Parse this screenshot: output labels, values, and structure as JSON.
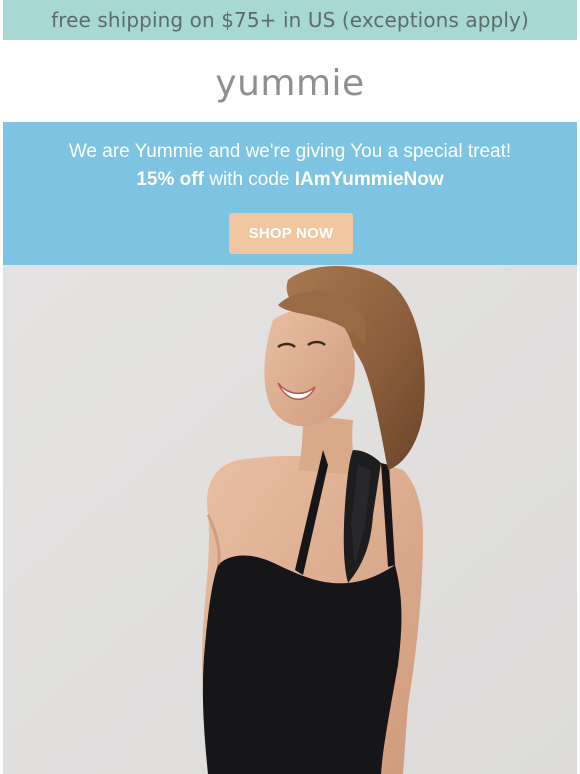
{
  "shipping_bar": {
    "text": "free shipping on $75+ in US (exceptions apply)"
  },
  "brand": {
    "logo_text": "yummie"
  },
  "promo": {
    "line1": "We are Yummie and we're giving You a special treat!",
    "line2_prefix": "15% off",
    "line2_middle": " with code ",
    "code": "IAmYummieNow",
    "button_label": "SHOP NOW"
  },
  "colors": {
    "shipping_bar_bg": "#a8d8d4",
    "promo_bg": "#7cc4e1",
    "button_bg": "#f0c7a0",
    "hero_bg": "#e1e0df"
  },
  "hero": {
    "icon": "model-photo"
  }
}
